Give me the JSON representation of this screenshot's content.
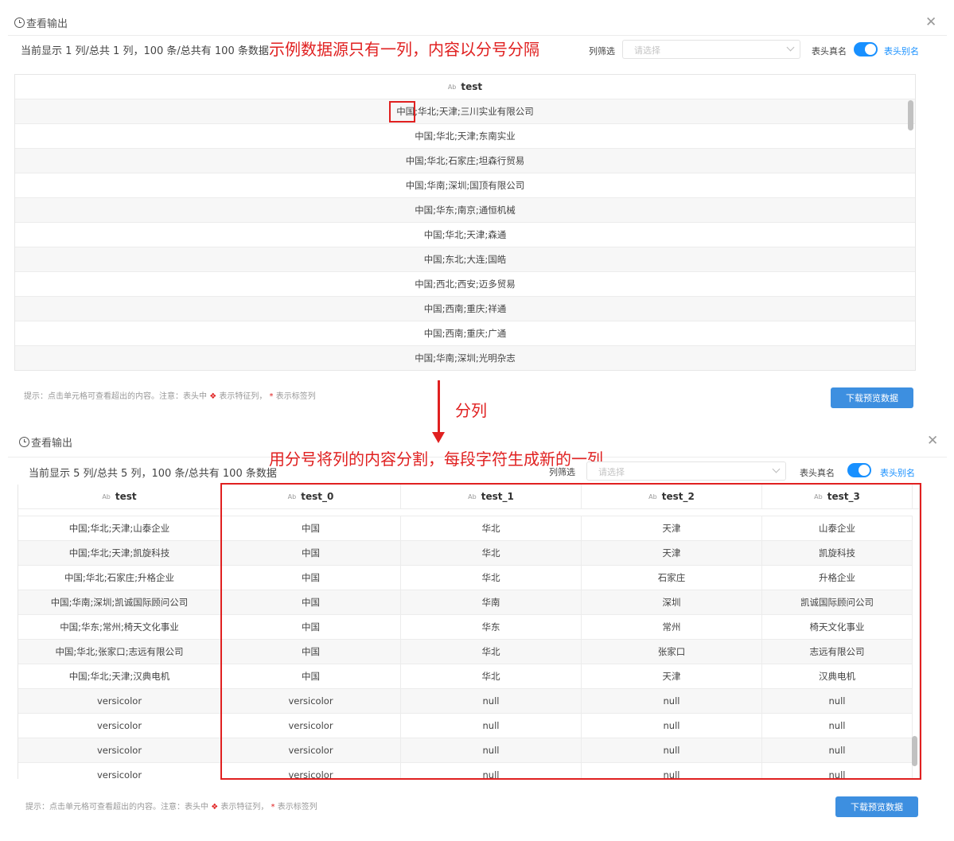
{
  "panel1": {
    "title": "查看输出",
    "info": "当前显示 1 列/总共 1 列，100 条/总共有 100 条数据",
    "annotation": "示例数据源只有一列，内容以分号分隔",
    "filter_label": "列筛选",
    "filter_placeholder": "请选择",
    "toggle_label": "表头真名",
    "alias_label": "表头别名",
    "column_header": "test",
    "rows": [
      "中国;华北;天津;三川实业有限公司",
      "中国;华北;天津;东南实业",
      "中国;华北;石家庄;坦森行贸易",
      "中国;华南;深圳;国顶有限公司",
      "中国;华东;南京;通恒机械",
      "中国;华北;天津;森通",
      "中国;东北;大连;国皓",
      "中国;西北;西安;迈多贸易",
      "中国;西南;重庆;祥通",
      "中国;西南;重庆;广通",
      "中国;华南;深圳;光明杂志"
    ],
    "hint_prefix": "提示：点击单元格可查看超出的内容。注意：表头中",
    "hint_mid": "表示特征列，",
    "hint_suffix": "表示标签列",
    "download_button": "下载预览数据"
  },
  "split_label": "分列",
  "panel2": {
    "title": "查看输出",
    "annotation": "用分号将列的内容分割，每段字符生成新的一列",
    "info": "当前显示 5 列/总共 5 列，100 条/总共有 100 条数据",
    "filter_label": "列筛选",
    "filter_placeholder": "请选择",
    "toggle_label": "表头真名",
    "alias_label": "表头别名",
    "headers": [
      "test",
      "test_0",
      "test_1",
      "test_2",
      "test_3"
    ],
    "rows": [
      [
        "中国;华北;天津;山泰企业",
        "中国",
        "华北",
        "天津",
        "山泰企业"
      ],
      [
        "中国;华北;天津;凯旋科技",
        "中国",
        "华北",
        "天津",
        "凯旋科技"
      ],
      [
        "中国;华北;石家庄;升格企业",
        "中国",
        "华北",
        "石家庄",
        "升格企业"
      ],
      [
        "中国;华南;深圳;凯诚国际顾问公司",
        "中国",
        "华南",
        "深圳",
        "凯诚国际顾问公司"
      ],
      [
        "中国;华东;常州;椅天文化事业",
        "中国",
        "华东",
        "常州",
        "椅天文化事业"
      ],
      [
        "中国;华北;张家口;志远有限公司",
        "中国",
        "华北",
        "张家口",
        "志远有限公司"
      ],
      [
        "中国;华北;天津;汉典电机",
        "中国",
        "华北",
        "天津",
        "汉典电机"
      ],
      [
        "versicolor",
        "versicolor",
        "null",
        "null",
        "null"
      ],
      [
        "versicolor",
        "versicolor",
        "null",
        "null",
        "null"
      ],
      [
        "versicolor",
        "versicolor",
        "null",
        "null",
        "null"
      ],
      [
        "versicolor",
        "versicolor",
        "null",
        "null",
        "null"
      ]
    ],
    "hint_prefix": "提示：点击单元格可查看超出的内容。注意：表头中",
    "hint_mid": "表示特征列，",
    "hint_suffix": "表示标签列",
    "download_button": "下载预览数据"
  },
  "type_icon": "Ab",
  "feature_icon": "feature-diamond-icon",
  "accent_color": "#1890ff",
  "annotation_color": "#e02020"
}
